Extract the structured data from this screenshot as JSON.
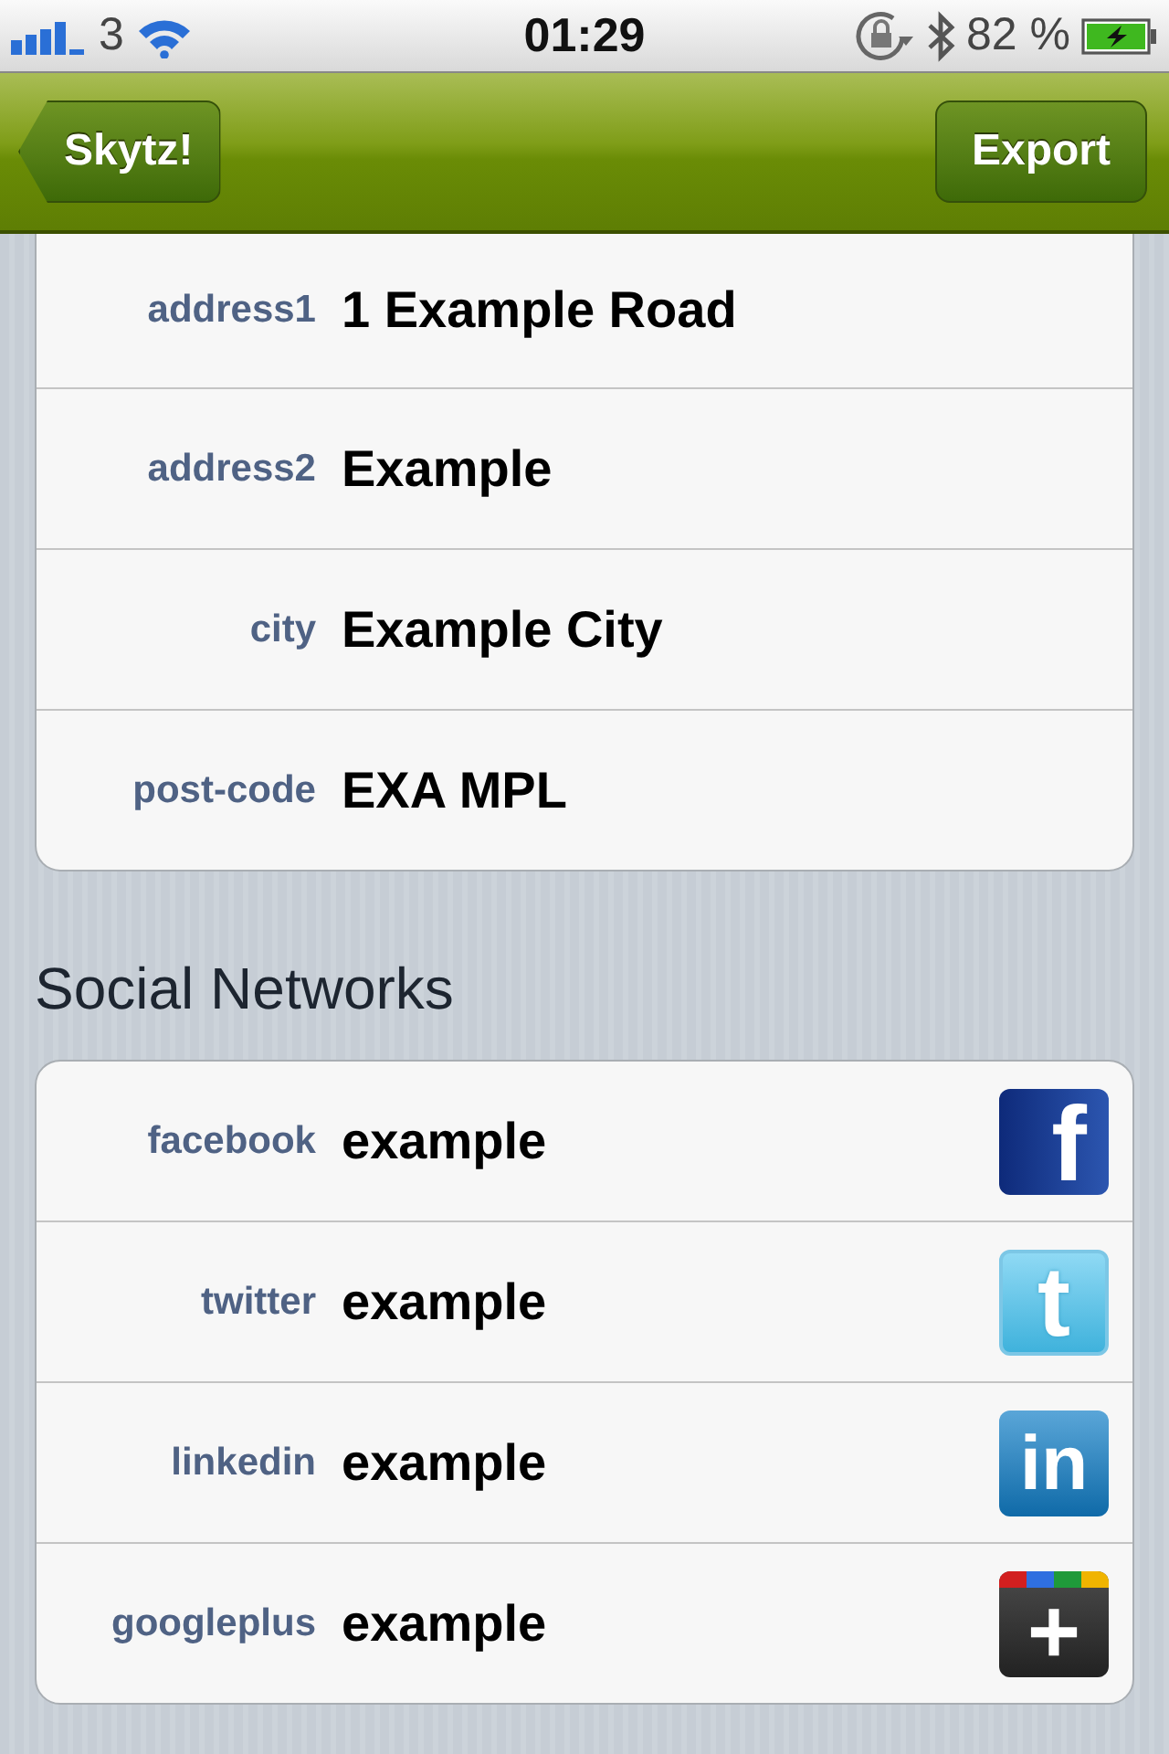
{
  "status_bar": {
    "carrier": "3",
    "time": "01:29",
    "battery": "82 %"
  },
  "nav_bar": {
    "back_button": "Skytz!",
    "action_button": "Export"
  },
  "address": [
    {
      "label": "address1",
      "value": "1 Example Road"
    },
    {
      "label": "address2",
      "value": "Example"
    },
    {
      "label": "city",
      "value": "Example City"
    },
    {
      "label": "post-code",
      "value": "EXA MPL"
    }
  ],
  "social_section": {
    "title": "Social Networks",
    "items": [
      {
        "label": "facebook",
        "value": "example",
        "kind": "facebook",
        "glyph": "f"
      },
      {
        "label": "twitter",
        "value": "example",
        "kind": "twitter",
        "glyph": "t"
      },
      {
        "label": "linkedin",
        "value": "example",
        "kind": "linkedin",
        "glyph": "in"
      },
      {
        "label": "googleplus",
        "value": "example",
        "kind": "googleplus",
        "glyph": "+"
      }
    ]
  }
}
